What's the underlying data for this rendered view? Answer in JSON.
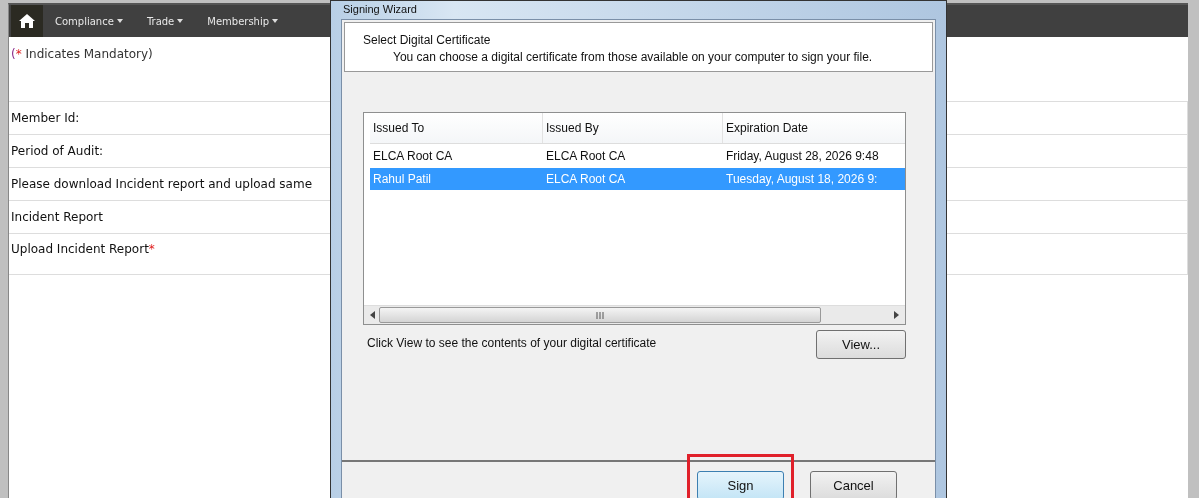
{
  "nav": {
    "items": [
      {
        "label": "Compliance"
      },
      {
        "label": "Trade"
      },
      {
        "label": "Membership"
      }
    ]
  },
  "mandatory_note": {
    "prefix": "(",
    "mark": "*",
    "text": " Indicates Mandatory)"
  },
  "form_rows": [
    {
      "label": "Member Id:"
    },
    {
      "label": "Period of Audit:"
    },
    {
      "label": "Please download Incident report and upload same"
    },
    {
      "label": "Incident Report"
    },
    {
      "label": "Upload Incident Report",
      "required_mark": "*"
    }
  ],
  "dialog": {
    "title": "Signing Wizard",
    "heading": "Select Digital Certificate",
    "description": "You can choose a digital certificate from those available on your computer to sign your file.",
    "table": {
      "columns": [
        "Issued To",
        "Issued By",
        "Expiration Date"
      ],
      "rows": [
        {
          "cells": [
            "ELCA Root CA",
            "ELCA Root CA",
            "Friday, August 28, 2026 9:48"
          ],
          "selected": false
        },
        {
          "cells": [
            "Rahul Patil",
            "ELCA Root CA",
            "Tuesday, August 18, 2026 9:"
          ],
          "selected": true
        }
      ]
    },
    "hint": "Click View to see the contents of your digital certificate",
    "view_button": "View...",
    "buttons": [
      {
        "label": "Sign",
        "highlighted": true
      },
      {
        "label": "Cancel",
        "highlighted": false
      }
    ]
  }
}
